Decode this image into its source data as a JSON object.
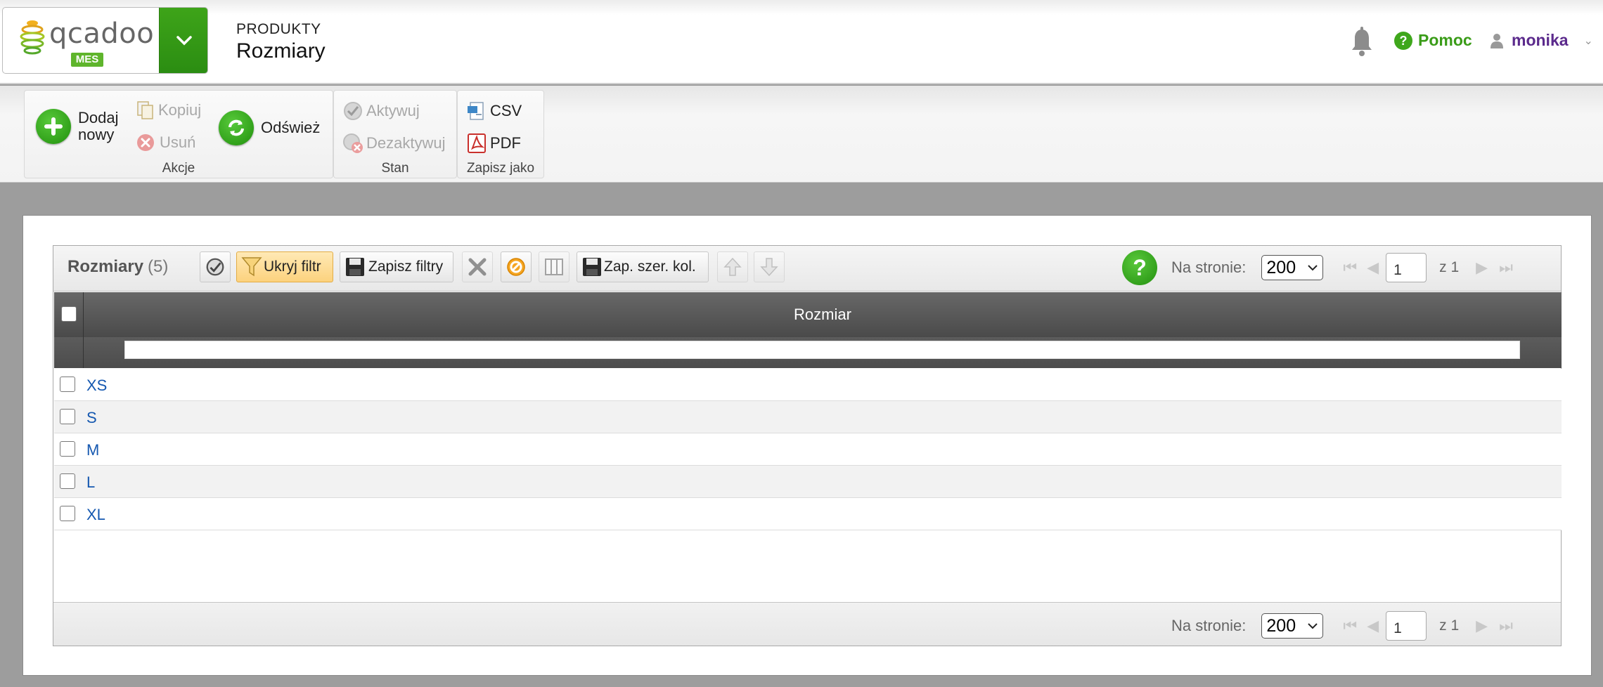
{
  "header": {
    "logo_text": "qcadoo",
    "logo_badge": "MES",
    "breadcrumb_section": "PRODUKTY",
    "breadcrumb_page": "Rozmiary",
    "help_label": "Pomoc",
    "user_label": "monika"
  },
  "ribbon": {
    "groups": {
      "actions": {
        "label": "Akcje",
        "add_new": "Dodaj nowy",
        "add_new_line1": "Dodaj",
        "add_new_line2": "nowy",
        "copy": "Kopiuj",
        "delete": "Usuń",
        "refresh": "Odśwież"
      },
      "state": {
        "label": "Stan",
        "activate": "Aktywuj",
        "deactivate": "Dezaktywuj"
      },
      "export": {
        "label": "Zapisz jako",
        "csv": "CSV",
        "pdf": "PDF"
      }
    }
  },
  "grid": {
    "title": "Rozmiary",
    "count": "(5)",
    "toolbar": {
      "hide_filter": "Ukryj filtr",
      "save_filters": "Zapisz filtry",
      "save_col_widths": "Zap. szer. kol."
    },
    "pager": {
      "per_page_label": "Na stronie:",
      "per_page_value": "200",
      "page_value": "1",
      "of_label": "z 1"
    },
    "column_header": "Rozmiar",
    "rows": [
      "XS",
      "S",
      "M",
      "L",
      "XL"
    ]
  },
  "colors": {
    "brand_green": "#3ea419",
    "link_blue": "#1558b0",
    "user_purple": "#5b2a8c"
  }
}
